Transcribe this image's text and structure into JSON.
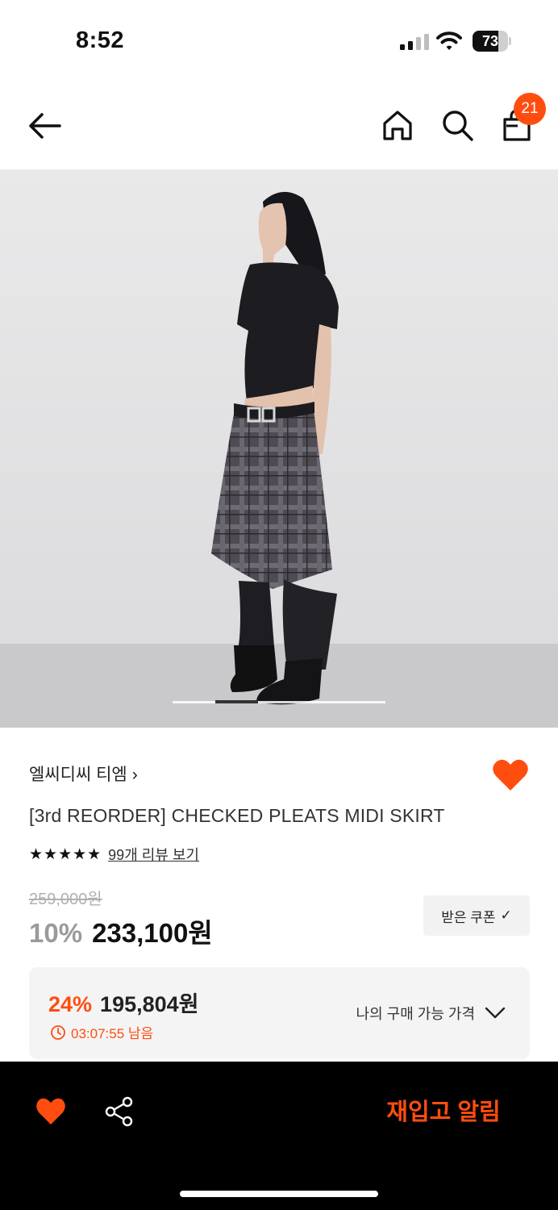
{
  "status_bar": {
    "time": "8:52",
    "battery_level": "73",
    "battery_fraction": 0.73,
    "icons": [
      "signal-icon",
      "wifi-icon",
      "battery-icon"
    ]
  },
  "header": {
    "icons": [
      "back-arrow-icon",
      "home-icon",
      "search-icon",
      "shopping-bag-icon"
    ],
    "cart_count": "21"
  },
  "product": {
    "image_pager": {
      "total_slides": 5,
      "current_slide": 2
    },
    "brand": "엘씨디씨 티엠",
    "brand_chevron": "›",
    "name": "[3rd REORDER] CHECKED PLEATS MIDI SKIRT",
    "stars": "★★★★★",
    "rating_value": 5,
    "reviews_label": "99개 리뷰 보기",
    "original_price": "259,000원",
    "discount_rate": "10%",
    "sale_price": "233,100원",
    "coupon_label": "받은 쿠폰",
    "coupon_check": "✓"
  },
  "my_price": {
    "rate": "24%",
    "price": "195,804원",
    "timer": "03:07:55 남음",
    "label": "나의 구매 가능 가격"
  },
  "bottom_bar": {
    "restock_label": "재입고 알림"
  },
  "colors": {
    "accent": "#ff4d10",
    "heart": "#ff4d10",
    "bottom_bar_bg": "#000000"
  }
}
